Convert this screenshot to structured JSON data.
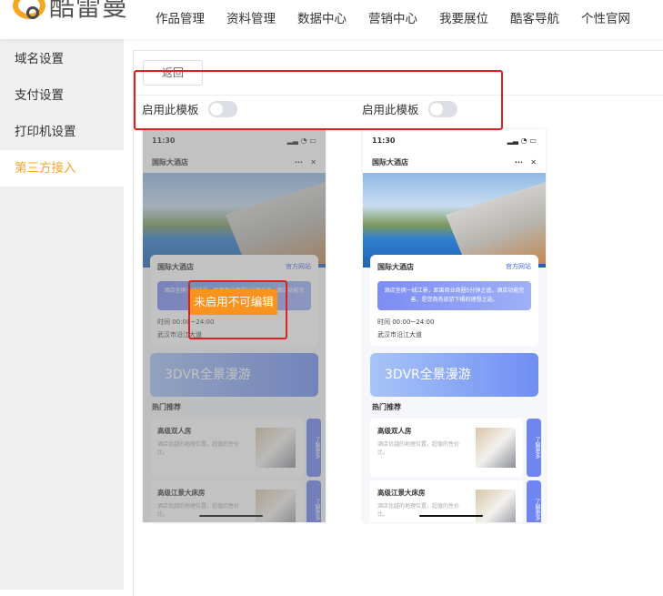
{
  "header": {
    "logo_text": "酷雷曼",
    "nav": [
      "作品管理",
      "资料管理",
      "数据中心",
      "营销中心",
      "我要展位",
      "酷客导航",
      "个性官网"
    ]
  },
  "sidebar": {
    "items": [
      {
        "label": "域名设置"
      },
      {
        "label": "支付设置"
      },
      {
        "label": "打印机设置"
      },
      {
        "label": "第三方接入",
        "active": true
      }
    ]
  },
  "main": {
    "back_label": "返回",
    "templates": [
      {
        "toggle_label": "启用此模板",
        "enabled": false,
        "overlay_label": "未启用不可编辑"
      },
      {
        "toggle_label": "启用此模板",
        "enabled": false
      }
    ]
  },
  "phone": {
    "time": "11:30",
    "title": "国际大酒店",
    "more": "···",
    "close": "✕",
    "card_title": "国际大酒店",
    "site_label": "官方网站",
    "desc": "酒店坐拥一线江景，距离商业商圈5分钟之遥。酒店功能完善，是您商务旅游下榻的理想之选。",
    "hours": "时间  00:00~24:00",
    "address": "武汉市沿江大道",
    "vr_label": "3DVR全景漫游",
    "hot_label": "热门推荐",
    "rooms": [
      {
        "name": "高级双人房",
        "desc": "酒店优越的地理位置，超值的性价比。",
        "more": "了解更多"
      },
      {
        "name": "高级江景大床房",
        "desc": "酒店优越的地理位置，超值的性价比。",
        "more": "了解更多"
      }
    ]
  },
  "colors": {
    "accent": "#f5a623",
    "highlight": "#e02020",
    "label_bg": "#f7931e"
  }
}
